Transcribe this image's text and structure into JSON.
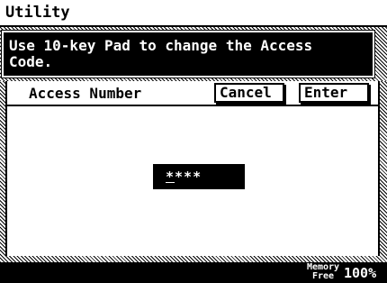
{
  "window": {
    "title": "Utility"
  },
  "message": {
    "text": "Use 10-key Pad to change the Access\nCode."
  },
  "form": {
    "field_label": "Access Number",
    "cancel_label": "Cancel",
    "enter_label": "Enter",
    "pin_first": "*",
    "pin_rest": "***"
  },
  "status": {
    "memory_line1": "Memory",
    "memory_line2": "Free",
    "memory_value": "100%"
  }
}
